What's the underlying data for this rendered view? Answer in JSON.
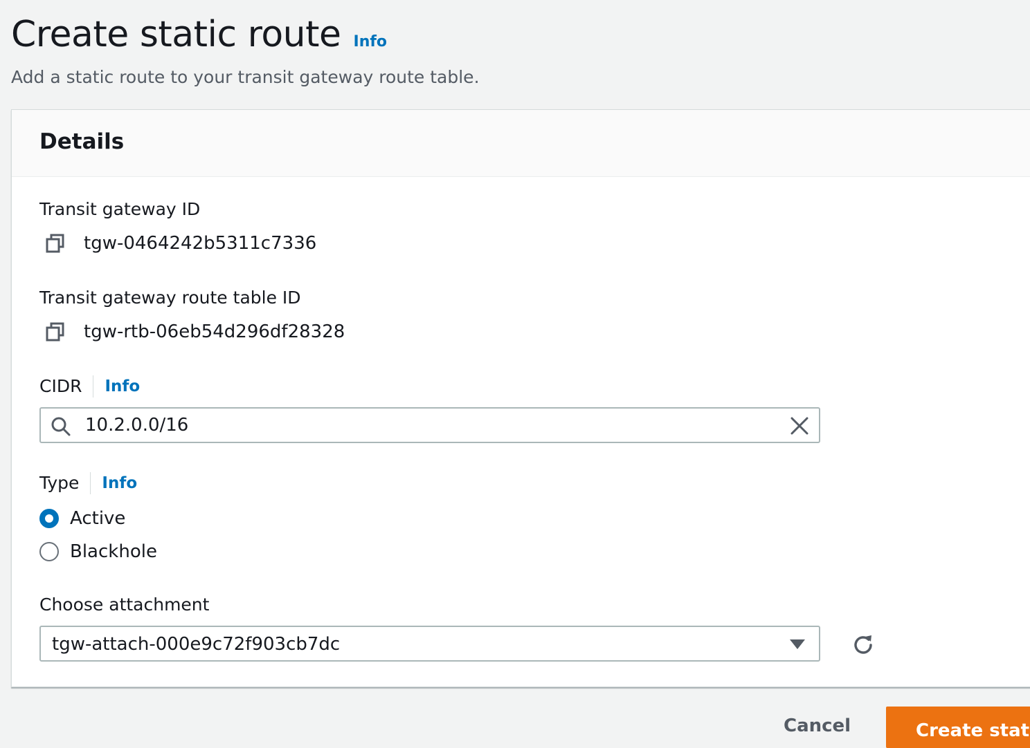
{
  "header": {
    "title": "Create static route",
    "info_label": "Info",
    "description": "Add a static route to your transit gateway route table."
  },
  "details": {
    "title": "Details",
    "transit_gateway": {
      "label": "Transit gateway ID",
      "value": "tgw-0464242b5311c7336",
      "icon": "copy-icon"
    },
    "route_table": {
      "label": "Transit gateway route table ID",
      "value": "tgw-rtb-06eb54d296df28328",
      "icon": "copy-icon"
    },
    "cidr": {
      "label": "CIDR",
      "info_label": "Info",
      "value": "10.2.0.0/16"
    },
    "type": {
      "label": "Type",
      "info_label": "Info",
      "options": [
        {
          "label": "Active",
          "checked": true
        },
        {
          "label": "Blackhole",
          "checked": false
        }
      ]
    },
    "attachment": {
      "label": "Choose attachment",
      "selected": "tgw-attach-000e9c72f903cb7dc"
    }
  },
  "footer": {
    "cancel_label": "Cancel",
    "submit_label": "Create static route"
  },
  "colors": {
    "accent": "#0073bb",
    "primary_button": "#ec7211",
    "background": "#f2f3f3"
  }
}
